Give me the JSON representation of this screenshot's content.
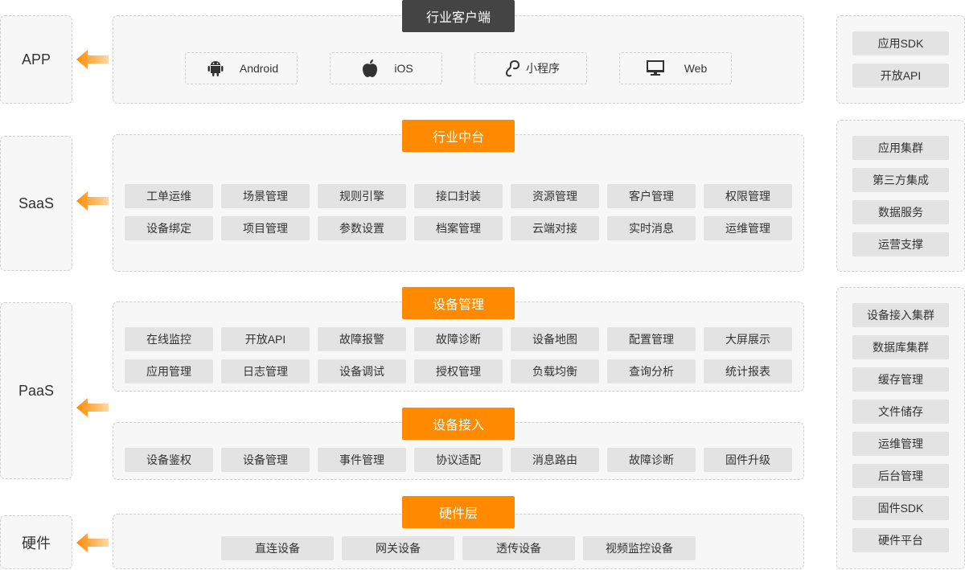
{
  "left_labels": [
    "APP",
    "SaaS",
    "PaaS",
    "硬件"
  ],
  "sections": {
    "client": {
      "title": "行业客户端",
      "items": [
        {
          "label": "Android",
          "icon": "android-icon"
        },
        {
          "label": "iOS",
          "icon": "apple-icon"
        },
        {
          "label": "小程序",
          "icon": "mini-program-icon"
        },
        {
          "label": "Web",
          "icon": "monitor-icon"
        }
      ]
    },
    "middle": {
      "title": "行业中台",
      "row1": [
        "工单运维",
        "场景管理",
        "规则引擎",
        "接口封装",
        "资源管理",
        "客户管理",
        "权限管理"
      ],
      "row2": [
        "设备绑定",
        "项目管理",
        "参数设置",
        "档案管理",
        "云端对接",
        "实时消息",
        "运维管理"
      ]
    },
    "device_mgmt": {
      "title": "设备管理",
      "row1": [
        "在线监控",
        "开放API",
        "故障报警",
        "故障诊断",
        "设备地图",
        "配置管理",
        "大屏展示"
      ],
      "row2": [
        "应用管理",
        "日志管理",
        "设备调试",
        "授权管理",
        "负载均衡",
        "查询分析",
        "统计报表"
      ]
    },
    "device_access": {
      "title": "设备接入",
      "row1": [
        "设备鉴权",
        "设备管理",
        "事件管理",
        "协议适配",
        "消息路由",
        "故障诊断",
        "固件升级"
      ]
    },
    "hardware": {
      "title": "硬件层",
      "row1": [
        "直连设备",
        "网关设备",
        "透传设备",
        "视频监控设备"
      ]
    }
  },
  "right": {
    "group1": [
      "应用SDK",
      "开放API"
    ],
    "group2": [
      "应用集群",
      "第三方集成",
      "数据服务",
      "运营支撑"
    ],
    "group3": [
      "设备接入集群",
      "数据库集群",
      "缓存管理",
      "文件储存",
      "运维管理",
      "后台管理",
      "固件SDK",
      "硬件平台"
    ]
  },
  "colors": {
    "accent": "#ff8a00",
    "dark_header": "#444444",
    "chip": "#e3e3e3"
  }
}
